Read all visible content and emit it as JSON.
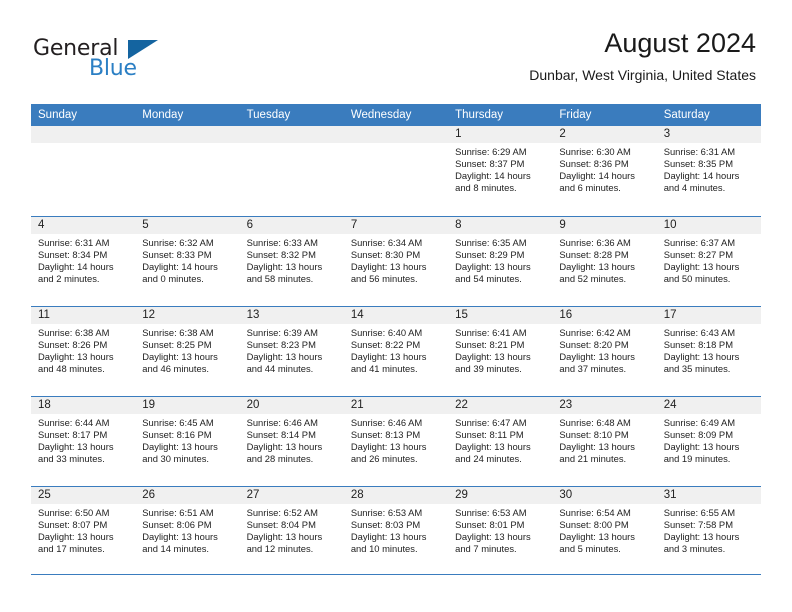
{
  "brand": {
    "name_part1": "General",
    "name_part2": "Blue",
    "accent_color": "#2b7fc4",
    "triangle_color": "#1464a0"
  },
  "header": {
    "title": "August 2024",
    "subtitle": "Dunbar, West Virginia, United States"
  },
  "theme": {
    "header_row_color": "#3a7cbe",
    "daynum_band_color": "#f0f0f0",
    "grid_line_color": "#3a7cbe"
  },
  "weekdays": [
    "Sunday",
    "Monday",
    "Tuesday",
    "Wednesday",
    "Thursday",
    "Friday",
    "Saturday"
  ],
  "weeks": [
    [
      {
        "day": "",
        "sunrise": "",
        "sunset": "",
        "daylight1": "",
        "daylight2": ""
      },
      {
        "day": "",
        "sunrise": "",
        "sunset": "",
        "daylight1": "",
        "daylight2": ""
      },
      {
        "day": "",
        "sunrise": "",
        "sunset": "",
        "daylight1": "",
        "daylight2": ""
      },
      {
        "day": "",
        "sunrise": "",
        "sunset": "",
        "daylight1": "",
        "daylight2": ""
      },
      {
        "day": "1",
        "sunrise": "Sunrise: 6:29 AM",
        "sunset": "Sunset: 8:37 PM",
        "daylight1": "Daylight: 14 hours",
        "daylight2": "and 8 minutes."
      },
      {
        "day": "2",
        "sunrise": "Sunrise: 6:30 AM",
        "sunset": "Sunset: 8:36 PM",
        "daylight1": "Daylight: 14 hours",
        "daylight2": "and 6 minutes."
      },
      {
        "day": "3",
        "sunrise": "Sunrise: 6:31 AM",
        "sunset": "Sunset: 8:35 PM",
        "daylight1": "Daylight: 14 hours",
        "daylight2": "and 4 minutes."
      }
    ],
    [
      {
        "day": "4",
        "sunrise": "Sunrise: 6:31 AM",
        "sunset": "Sunset: 8:34 PM",
        "daylight1": "Daylight: 14 hours",
        "daylight2": "and 2 minutes."
      },
      {
        "day": "5",
        "sunrise": "Sunrise: 6:32 AM",
        "sunset": "Sunset: 8:33 PM",
        "daylight1": "Daylight: 14 hours",
        "daylight2": "and 0 minutes."
      },
      {
        "day": "6",
        "sunrise": "Sunrise: 6:33 AM",
        "sunset": "Sunset: 8:32 PM",
        "daylight1": "Daylight: 13 hours",
        "daylight2": "and 58 minutes."
      },
      {
        "day": "7",
        "sunrise": "Sunrise: 6:34 AM",
        "sunset": "Sunset: 8:30 PM",
        "daylight1": "Daylight: 13 hours",
        "daylight2": "and 56 minutes."
      },
      {
        "day": "8",
        "sunrise": "Sunrise: 6:35 AM",
        "sunset": "Sunset: 8:29 PM",
        "daylight1": "Daylight: 13 hours",
        "daylight2": "and 54 minutes."
      },
      {
        "day": "9",
        "sunrise": "Sunrise: 6:36 AM",
        "sunset": "Sunset: 8:28 PM",
        "daylight1": "Daylight: 13 hours",
        "daylight2": "and 52 minutes."
      },
      {
        "day": "10",
        "sunrise": "Sunrise: 6:37 AM",
        "sunset": "Sunset: 8:27 PM",
        "daylight1": "Daylight: 13 hours",
        "daylight2": "and 50 minutes."
      }
    ],
    [
      {
        "day": "11",
        "sunrise": "Sunrise: 6:38 AM",
        "sunset": "Sunset: 8:26 PM",
        "daylight1": "Daylight: 13 hours",
        "daylight2": "and 48 minutes."
      },
      {
        "day": "12",
        "sunrise": "Sunrise: 6:38 AM",
        "sunset": "Sunset: 8:25 PM",
        "daylight1": "Daylight: 13 hours",
        "daylight2": "and 46 minutes."
      },
      {
        "day": "13",
        "sunrise": "Sunrise: 6:39 AM",
        "sunset": "Sunset: 8:23 PM",
        "daylight1": "Daylight: 13 hours",
        "daylight2": "and 44 minutes."
      },
      {
        "day": "14",
        "sunrise": "Sunrise: 6:40 AM",
        "sunset": "Sunset: 8:22 PM",
        "daylight1": "Daylight: 13 hours",
        "daylight2": "and 41 minutes."
      },
      {
        "day": "15",
        "sunrise": "Sunrise: 6:41 AM",
        "sunset": "Sunset: 8:21 PM",
        "daylight1": "Daylight: 13 hours",
        "daylight2": "and 39 minutes."
      },
      {
        "day": "16",
        "sunrise": "Sunrise: 6:42 AM",
        "sunset": "Sunset: 8:20 PM",
        "daylight1": "Daylight: 13 hours",
        "daylight2": "and 37 minutes."
      },
      {
        "day": "17",
        "sunrise": "Sunrise: 6:43 AM",
        "sunset": "Sunset: 8:18 PM",
        "daylight1": "Daylight: 13 hours",
        "daylight2": "and 35 minutes."
      }
    ],
    [
      {
        "day": "18",
        "sunrise": "Sunrise: 6:44 AM",
        "sunset": "Sunset: 8:17 PM",
        "daylight1": "Daylight: 13 hours",
        "daylight2": "and 33 minutes."
      },
      {
        "day": "19",
        "sunrise": "Sunrise: 6:45 AM",
        "sunset": "Sunset: 8:16 PM",
        "daylight1": "Daylight: 13 hours",
        "daylight2": "and 30 minutes."
      },
      {
        "day": "20",
        "sunrise": "Sunrise: 6:46 AM",
        "sunset": "Sunset: 8:14 PM",
        "daylight1": "Daylight: 13 hours",
        "daylight2": "and 28 minutes."
      },
      {
        "day": "21",
        "sunrise": "Sunrise: 6:46 AM",
        "sunset": "Sunset: 8:13 PM",
        "daylight1": "Daylight: 13 hours",
        "daylight2": "and 26 minutes."
      },
      {
        "day": "22",
        "sunrise": "Sunrise: 6:47 AM",
        "sunset": "Sunset: 8:11 PM",
        "daylight1": "Daylight: 13 hours",
        "daylight2": "and 24 minutes."
      },
      {
        "day": "23",
        "sunrise": "Sunrise: 6:48 AM",
        "sunset": "Sunset: 8:10 PM",
        "daylight1": "Daylight: 13 hours",
        "daylight2": "and 21 minutes."
      },
      {
        "day": "24",
        "sunrise": "Sunrise: 6:49 AM",
        "sunset": "Sunset: 8:09 PM",
        "daylight1": "Daylight: 13 hours",
        "daylight2": "and 19 minutes."
      }
    ],
    [
      {
        "day": "25",
        "sunrise": "Sunrise: 6:50 AM",
        "sunset": "Sunset: 8:07 PM",
        "daylight1": "Daylight: 13 hours",
        "daylight2": "and 17 minutes."
      },
      {
        "day": "26",
        "sunrise": "Sunrise: 6:51 AM",
        "sunset": "Sunset: 8:06 PM",
        "daylight1": "Daylight: 13 hours",
        "daylight2": "and 14 minutes."
      },
      {
        "day": "27",
        "sunrise": "Sunrise: 6:52 AM",
        "sunset": "Sunset: 8:04 PM",
        "daylight1": "Daylight: 13 hours",
        "daylight2": "and 12 minutes."
      },
      {
        "day": "28",
        "sunrise": "Sunrise: 6:53 AM",
        "sunset": "Sunset: 8:03 PM",
        "daylight1": "Daylight: 13 hours",
        "daylight2": "and 10 minutes."
      },
      {
        "day": "29",
        "sunrise": "Sunrise: 6:53 AM",
        "sunset": "Sunset: 8:01 PM",
        "daylight1": "Daylight: 13 hours",
        "daylight2": "and 7 minutes."
      },
      {
        "day": "30",
        "sunrise": "Sunrise: 6:54 AM",
        "sunset": "Sunset: 8:00 PM",
        "daylight1": "Daylight: 13 hours",
        "daylight2": "and 5 minutes."
      },
      {
        "day": "31",
        "sunrise": "Sunrise: 6:55 AM",
        "sunset": "Sunset: 7:58 PM",
        "daylight1": "Daylight: 13 hours",
        "daylight2": "and 3 minutes."
      }
    ]
  ]
}
